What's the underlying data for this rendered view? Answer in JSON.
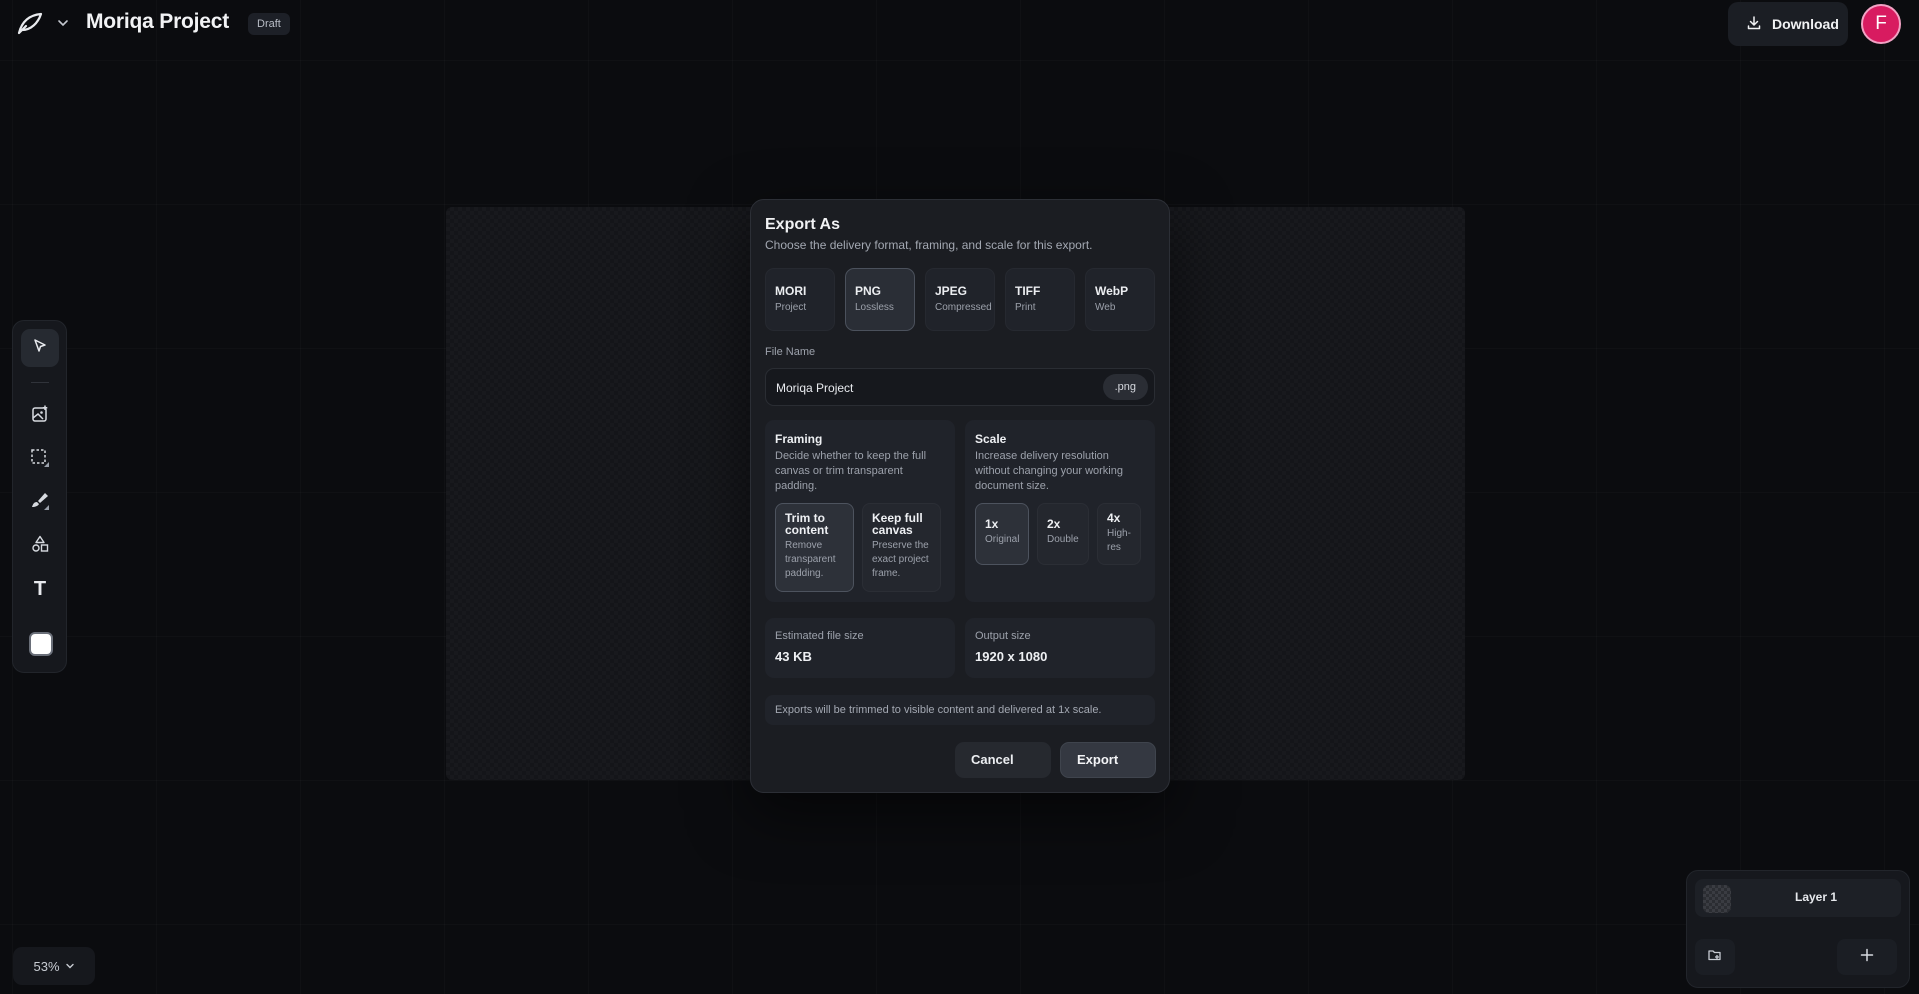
{
  "header": {
    "project_title": "Moriqa Project",
    "status_badge": "Draft",
    "download_label": "Download",
    "avatar_initial": "F"
  },
  "toolbar": {
    "tools": [
      "select-tool",
      "image-tool",
      "marquee-tool",
      "brush-tool",
      "shapes-tool",
      "text-tool"
    ],
    "text_tool_glyph": "T",
    "active_tool": "select-tool",
    "color_swatch": "#ffffff"
  },
  "zoom": {
    "level": "53%"
  },
  "layers": {
    "layer_name": "Layer 1"
  },
  "export_dialog": {
    "title": "Export As",
    "subtitle": "Choose the delivery format, framing, and scale for this export.",
    "formats": [
      {
        "name": "MORI",
        "desc": "Project"
      },
      {
        "name": "PNG",
        "desc": "Lossless"
      },
      {
        "name": "JPEG",
        "desc": "Compressed"
      },
      {
        "name": "TIFF",
        "desc": "Print"
      },
      {
        "name": "WebP",
        "desc": "Web"
      }
    ],
    "selected_format": "PNG",
    "file_name_label": "File Name",
    "file_name_value": "Moriqa Project",
    "file_extension": ".png",
    "framing": {
      "title": "Framing",
      "desc": "Decide whether to keep the full canvas or trim transparent padding.",
      "options": [
        {
          "name": "Trim to content",
          "desc": "Remove transparent padding."
        },
        {
          "name": "Keep full canvas",
          "desc": "Preserve the exact project frame."
        }
      ],
      "selected": "Trim to content"
    },
    "scale": {
      "title": "Scale",
      "desc": "Increase delivery resolution without changing your working document size.",
      "options": [
        {
          "name": "1x",
          "desc": "Original"
        },
        {
          "name": "2x",
          "desc": "Double"
        },
        {
          "name": "4x",
          "desc": "High-res"
        }
      ],
      "selected": "1x"
    },
    "estimated_size_label": "Estimated file size",
    "estimated_size_value": "43 KB",
    "output_size_label": "Output size",
    "output_size_value": "1920 x 1080",
    "note": "Exports will be trimmed to visible content and delivered at 1x scale.",
    "cancel_label": "Cancel",
    "export_label": "Export"
  },
  "colors": {
    "background": "#0b0c0f",
    "panel": "#16181d",
    "modal": "#1b1d22",
    "avatar": "#d81b60"
  }
}
